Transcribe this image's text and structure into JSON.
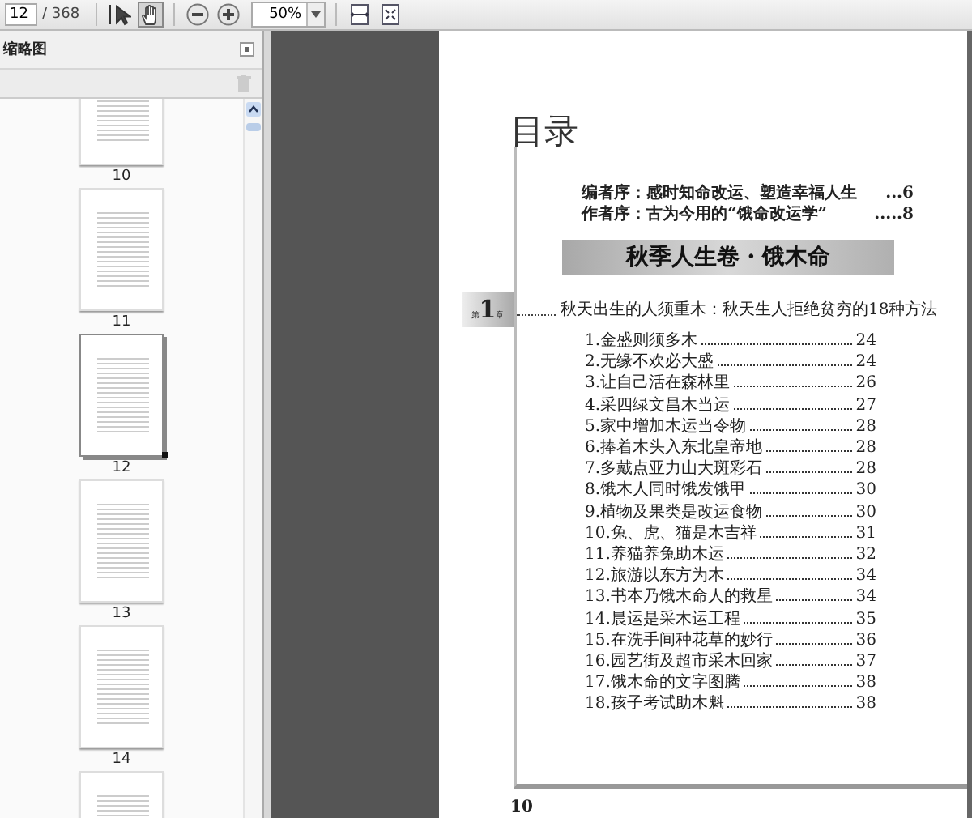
{
  "toolbar": {
    "page_input": "12",
    "page_count": "/ 368",
    "tools": [
      {
        "kind": "select",
        "selected": false
      },
      {
        "kind": "hand",
        "selected": true
      }
    ],
    "zoom": "50%"
  },
  "panel": {
    "title": "缩略图",
    "thumbnails": [
      {
        "label": "10",
        "selected": false
      },
      {
        "label": "11",
        "selected": false
      },
      {
        "label": "12",
        "selected": true
      },
      {
        "label": "13",
        "selected": false
      },
      {
        "label": "14",
        "selected": false
      },
      {
        "selected": false
      }
    ]
  },
  "document": {
    "title": "目录",
    "prefaces": [
      {
        "text": "编者序：感时知命改运、塑造幸福人生",
        "page": "...6"
      },
      {
        "text": "作者序：古为今用的“饿命改运学”",
        "page": ".....8"
      }
    ],
    "banner": "秋季人生卷・饿木命",
    "chapter": {
      "prefix": "第",
      "number": "1",
      "suffix": "章",
      "title": "秋天出生的人须重木：秋天生人拒绝贫穷的18种方法"
    },
    "entries": [
      {
        "text": "1.金盛则须多木",
        "page": "24"
      },
      {
        "text": "2.无缘不欢必大盛",
        "page": "24"
      },
      {
        "text": "3.让自己活在森林里",
        "page": "26"
      },
      {
        "text": "4.采四绿文昌木当运",
        "page": "27"
      },
      {
        "text": "5.家中增加木运当令物",
        "page": "28"
      },
      {
        "text": "6.捧着木头入东北皇帝地",
        "page": "28"
      },
      {
        "text": "7.多戴点亚力山大斑彩石",
        "page": "28"
      },
      {
        "text": "8.饿木人同时饿发饿甲",
        "page": "30"
      },
      {
        "text": "9.植物及果类是改运食物",
        "page": "30"
      },
      {
        "text": "10.兔、虎、猫是木吉祥",
        "page": "31"
      },
      {
        "text": "11.养猫养兔助木运",
        "page": "32"
      },
      {
        "text": "12.旅游以东方为木",
        "page": "34"
      },
      {
        "text": "13.书本乃饿木命人的救星",
        "page": "34"
      },
      {
        "text": "14.晨运是采木运工程",
        "page": "35"
      },
      {
        "text": "15.在洗手间种花草的妙行",
        "page": "36"
      },
      {
        "text": "16.园艺街及超市采木回家",
        "page": "37"
      },
      {
        "text": "17.饿木命的文字图腾",
        "page": "38"
      },
      {
        "text": "18.孩子考试助木魁",
        "page": "38"
      }
    ],
    "page_number": "10"
  }
}
